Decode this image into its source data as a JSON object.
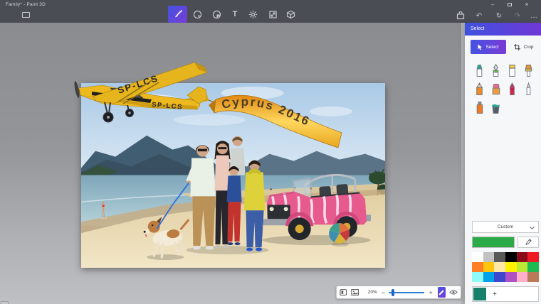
{
  "window": {
    "title": "Family* - Paint 3D",
    "minimize_glyph": "–",
    "close_glyph": "×"
  },
  "toolbar": {
    "tools": [
      "brush",
      "shapes-2d",
      "stickers",
      "text",
      "effects",
      "canvas",
      "library-3d"
    ],
    "text_tool_glyph": "T",
    "undo_glyph": "↶",
    "history_glyph": "↻",
    "redo_glyph": "↷",
    "more_glyph": "…"
  },
  "panel": {
    "title": "Select",
    "select_label": "Select",
    "crop_label": "Crop",
    "brushes": [
      "marker",
      "calligraphy-pen",
      "pixel-pen",
      "oil-brush",
      "pencil",
      "eraser",
      "crayon",
      "watercolor",
      "spray-can",
      "fill"
    ],
    "palette_dropdown": "Custom",
    "current_color": "#2BAB47",
    "palette": [
      "#FFFFFF",
      "#C3C3C3",
      "#585858",
      "#000000",
      "#8B0B1C",
      "#EC1B24",
      "#FF7F27",
      "#FFC40E",
      "#FFE9A9",
      "#FFF200",
      "#BCE835",
      "#1EB953",
      "#8CFBF9",
      "#00A3E8",
      "#3E48CC",
      "#B052C4",
      "#FFAFC9",
      "#B97A57"
    ],
    "custom_swatch": "#17806D",
    "add_color_glyph": "+"
  },
  "statusbar": {
    "zoom_level": "20%",
    "zoom_out_glyph": "−",
    "zoom_in_glyph": "+"
  },
  "artwork": {
    "banner_text": "Cyprus 2016",
    "plane_registration": "SP-LCS"
  },
  "accent": {
    "gradient_start": "#3F51E0",
    "gradient_end": "#7038D6",
    "slider_blue": "#2D7DD2"
  }
}
